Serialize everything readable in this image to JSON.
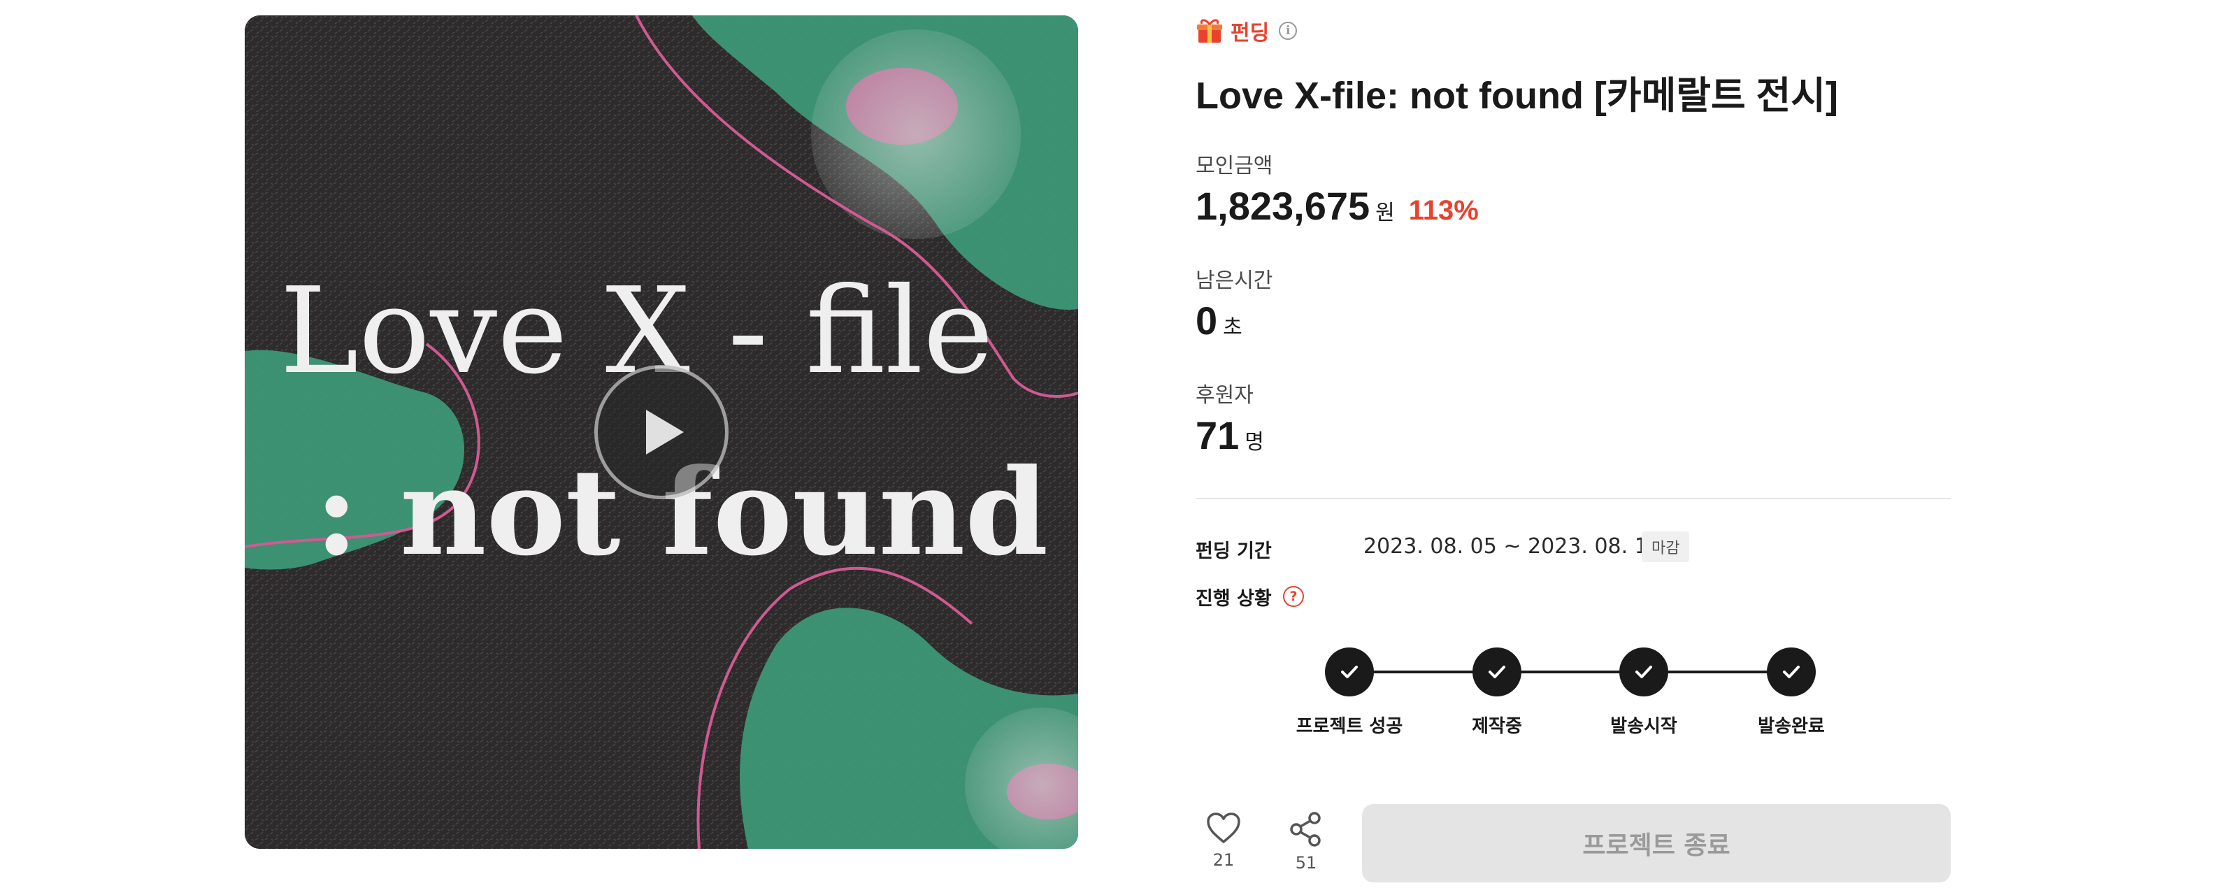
{
  "media": {
    "artwork_line1": "Love X - file",
    "artwork_line2": ": not found"
  },
  "category": {
    "label": "펀딩",
    "icon": "gift-icon"
  },
  "title": "Love X-file: not found [카메랄트 전시]",
  "stats": {
    "amount_label": "모인금액",
    "amount_value": "1,823,675",
    "amount_unit": "원",
    "amount_percent": "113%",
    "time_label": "남은시간",
    "time_value": "0",
    "time_unit": "초",
    "backers_label": "후원자",
    "backers_value": "71",
    "backers_unit": "명"
  },
  "period": {
    "label": "펀딩 기간",
    "value": "2023. 08. 05 ~ 2023. 08. 19",
    "badge": "마감"
  },
  "progress": {
    "label": "진행 상황",
    "steps": [
      {
        "label": "프로젝트 성공",
        "done": true
      },
      {
        "label": "제작중",
        "done": true
      },
      {
        "label": "발송시작",
        "done": true
      },
      {
        "label": "발송완료",
        "done": true
      }
    ]
  },
  "actions": {
    "like_count": "21",
    "share_count": "51",
    "end_button": "프로젝트 종료"
  },
  "colors": {
    "accent": "#e8422f",
    "step_dot": "#1a1a1a",
    "disabled_button": "#e4e4e4"
  }
}
